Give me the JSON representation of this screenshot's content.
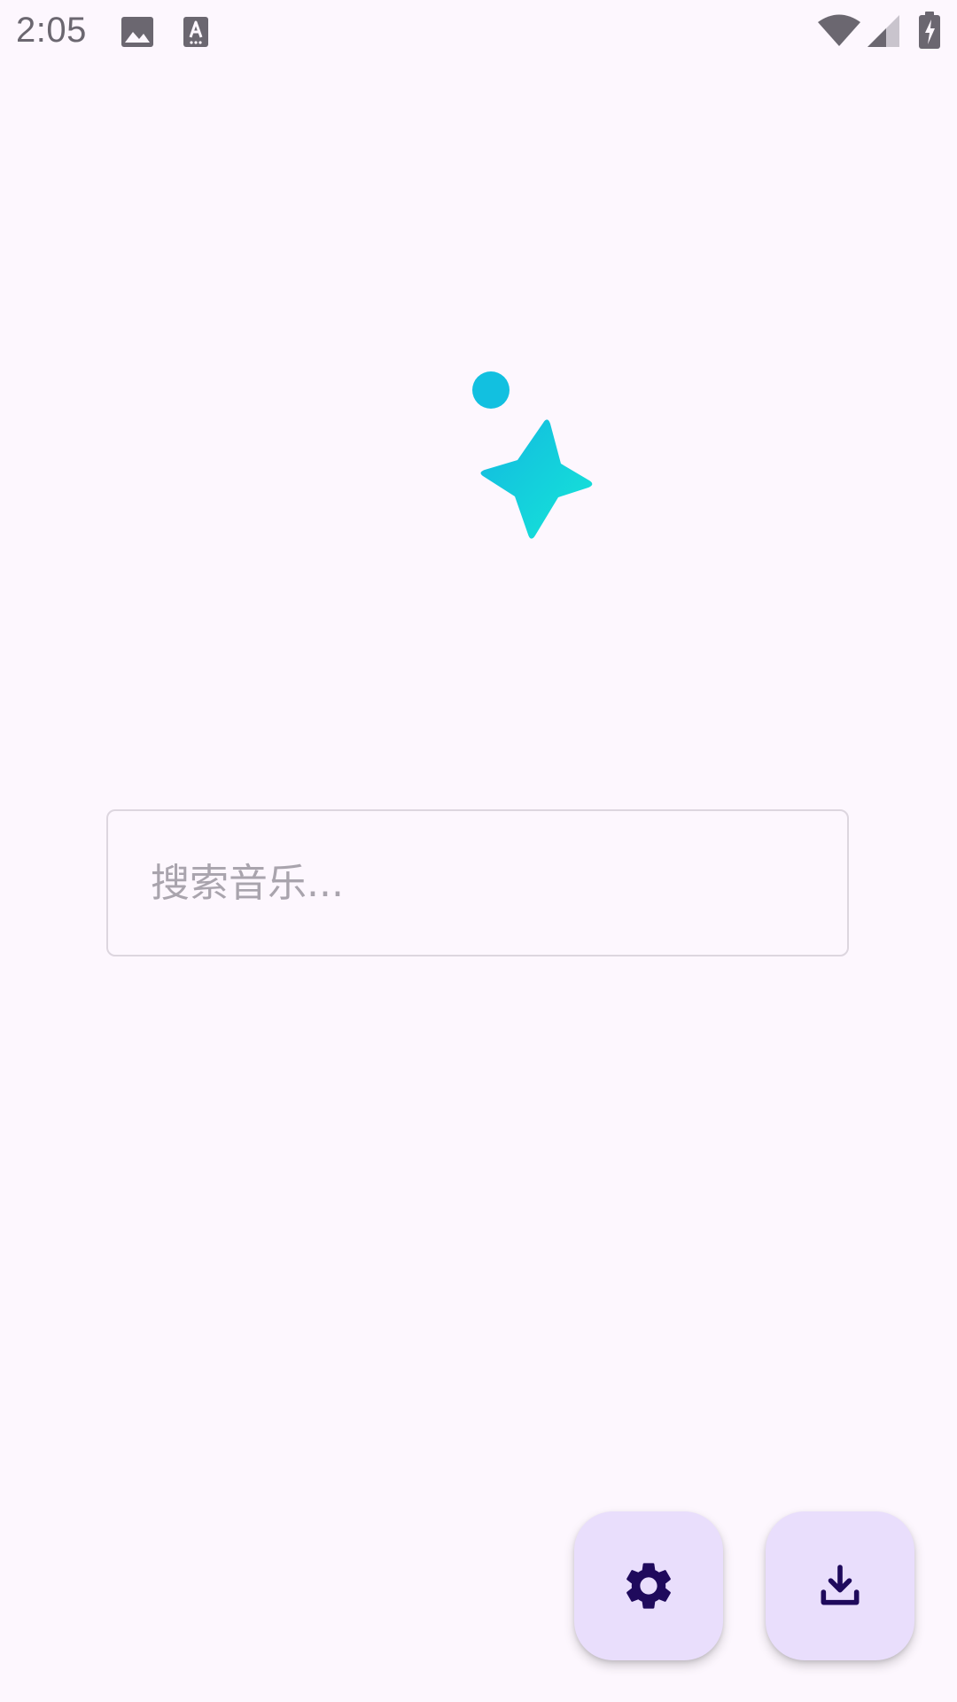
{
  "status_bar": {
    "time": "2:05",
    "icons": [
      "image-icon",
      "keyboard-icon",
      "wifi-icon",
      "signal-icon",
      "battery-charging-icon"
    ],
    "icon_color": "#6b6770"
  },
  "logo": {
    "icon": "sparkle-icon",
    "gradient_start": "#12b8e0",
    "gradient_end": "#16e6d8"
  },
  "search": {
    "placeholder": "搜索音乐...",
    "value": ""
  },
  "fabs": [
    {
      "icon": "gear-icon",
      "label": "settings"
    },
    {
      "icon": "download-icon",
      "label": "download"
    }
  ],
  "colors": {
    "background": "#fdf7fe",
    "fab_background": "#e9defc",
    "fab_icon": "#1f0a5c",
    "search_border": "#ddd6df",
    "placeholder": "#a9a4ad"
  }
}
